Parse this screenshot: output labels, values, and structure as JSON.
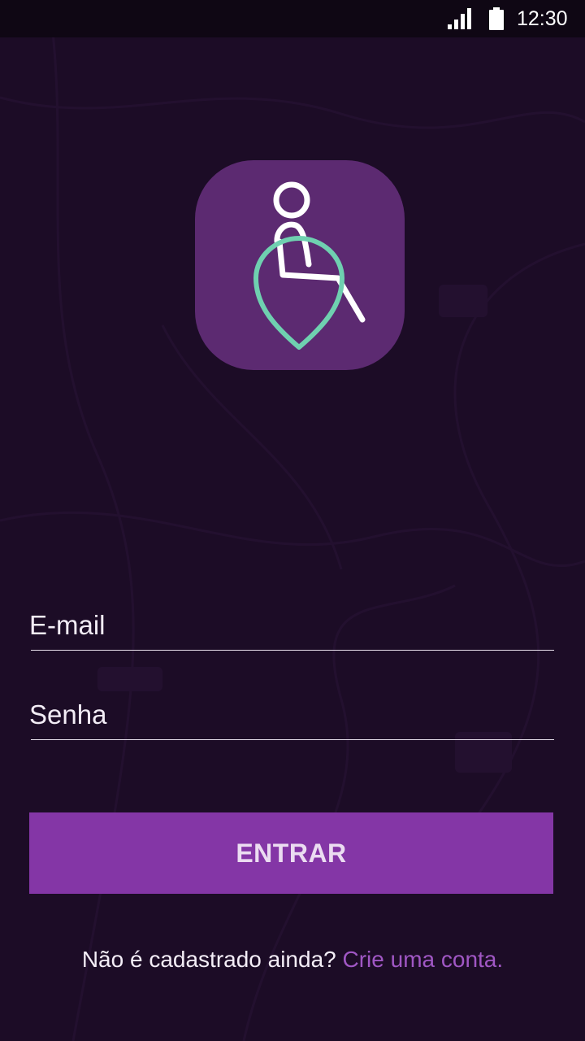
{
  "status_bar": {
    "time": "12:30",
    "signal_icon": "cell-signal-icon",
    "battery_icon": "battery-full-icon"
  },
  "app_icon": {
    "icon": "wheelchair-location-pin-icon",
    "background_color": "#5c2a71",
    "person_color": "#ffffff",
    "pin_color": "#6fd0b0"
  },
  "login_form": {
    "email_placeholder": "E-mail",
    "password_placeholder": "Senha",
    "submit_label": "ENTRAR"
  },
  "signup": {
    "prompt": "Não é cadastrado ainda?",
    "link": "Crie uma conta."
  },
  "colors": {
    "background": "#1c0c26",
    "button": "#8436a6",
    "link": "#a057c4"
  }
}
